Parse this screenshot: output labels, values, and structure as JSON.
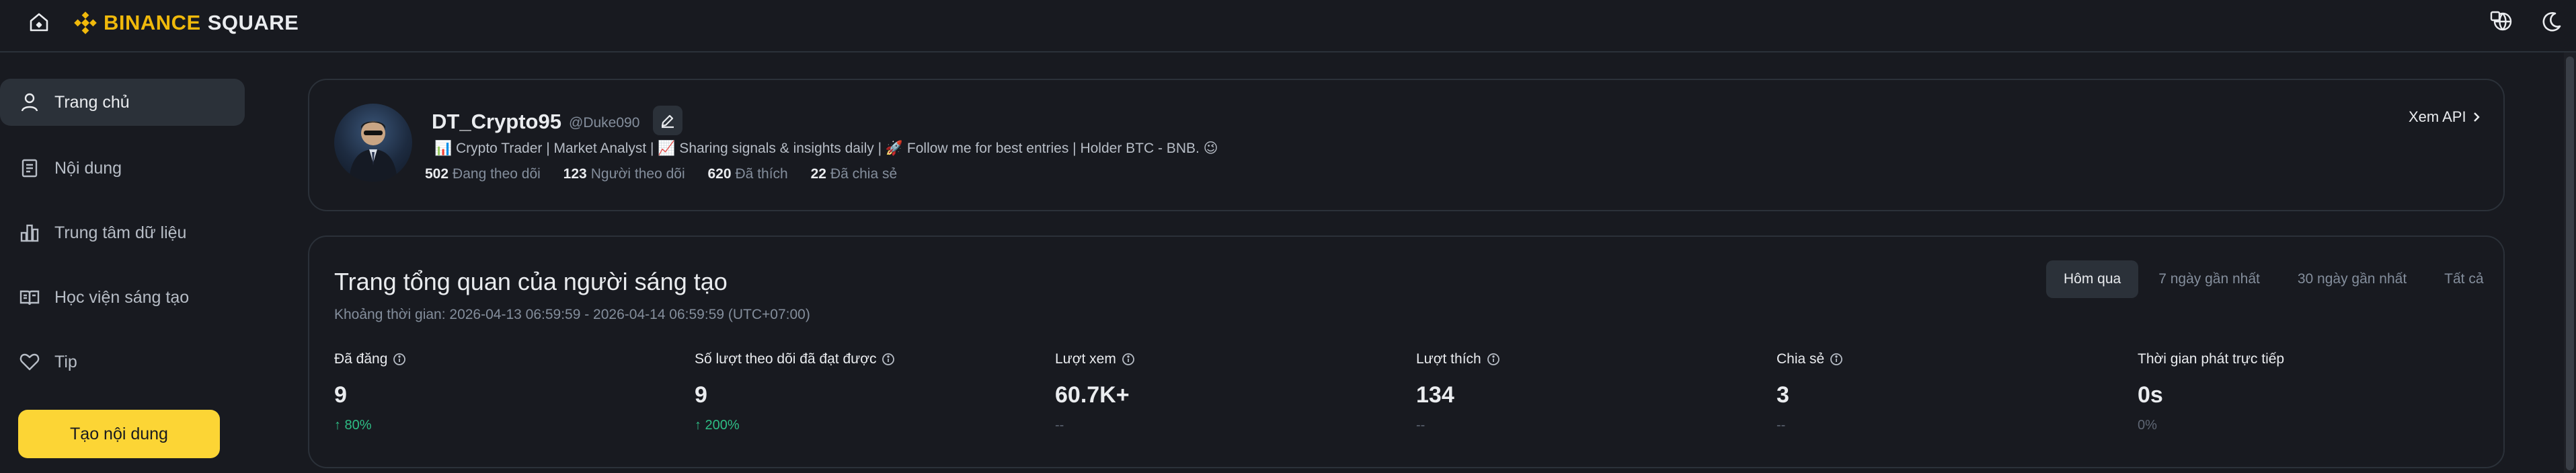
{
  "header": {
    "brand": "BINANCE",
    "product": "SQUARE"
  },
  "sidebar": {
    "items": [
      {
        "label": "Trang chủ",
        "icon": "user-icon",
        "active": true
      },
      {
        "label": "Nội dung",
        "icon": "document-icon",
        "active": false
      },
      {
        "label": "Trung tâm dữ liệu",
        "icon": "bar-chart-icon",
        "active": false
      },
      {
        "label": "Học viện sáng tạo",
        "icon": "book-icon",
        "active": false
      },
      {
        "label": "Tip",
        "icon": "heart-icon",
        "active": false
      }
    ],
    "create_button": "Tạo nội dung"
  },
  "profile": {
    "name": "DT_Crypto95",
    "handle": "@Duke090",
    "bio": "📊 Crypto Trader | Market Analyst | 📈 Sharing signals & insights daily | 🚀 Follow me for best entries | Holder BTC - BNB. 😉",
    "stats": [
      {
        "value": "502",
        "label": "Đang theo dõi"
      },
      {
        "value": "123",
        "label": "Người theo dõi"
      },
      {
        "value": "620",
        "label": "Đã thích"
      },
      {
        "value": "22",
        "label": "Đã chia sẻ"
      }
    ],
    "api_link": "Xem API"
  },
  "overview": {
    "title": "Trang tổng quan của người sáng tạo",
    "range": "Khoảng thời gian: 2026-04-13 06:59:59 - 2026-04-14 06:59:59 (UTC+07:00)",
    "tabs": [
      {
        "label": "Hôm qua",
        "active": true
      },
      {
        "label": "7 ngày gần nhất",
        "active": false
      },
      {
        "label": "30 ngày gần nhất",
        "active": false
      },
      {
        "label": "Tất cả",
        "active": false
      }
    ],
    "metrics": [
      {
        "label": "Đã đăng",
        "value": "9",
        "change": "↑ 80%",
        "trend": "up"
      },
      {
        "label": "Số lượt theo dõi đã đạt được",
        "value": "9",
        "change": "↑ 200%",
        "trend": "up"
      },
      {
        "label": "Lượt xem",
        "value": "60.7K+",
        "change": "--",
        "trend": "none"
      },
      {
        "label": "Lượt thích",
        "value": "134",
        "change": "--",
        "trend": "none"
      },
      {
        "label": "Chia sẻ",
        "value": "3",
        "change": "--",
        "trend": "none"
      },
      {
        "label": "Thời gian phát trực tiếp",
        "value": "0s",
        "change": "0%",
        "trend": "none"
      }
    ]
  },
  "colors": {
    "background": "#181a20",
    "accent": "#fcd535",
    "brand": "#f0b90b",
    "positive": "#2ebd85",
    "muted": "#848e9c"
  }
}
